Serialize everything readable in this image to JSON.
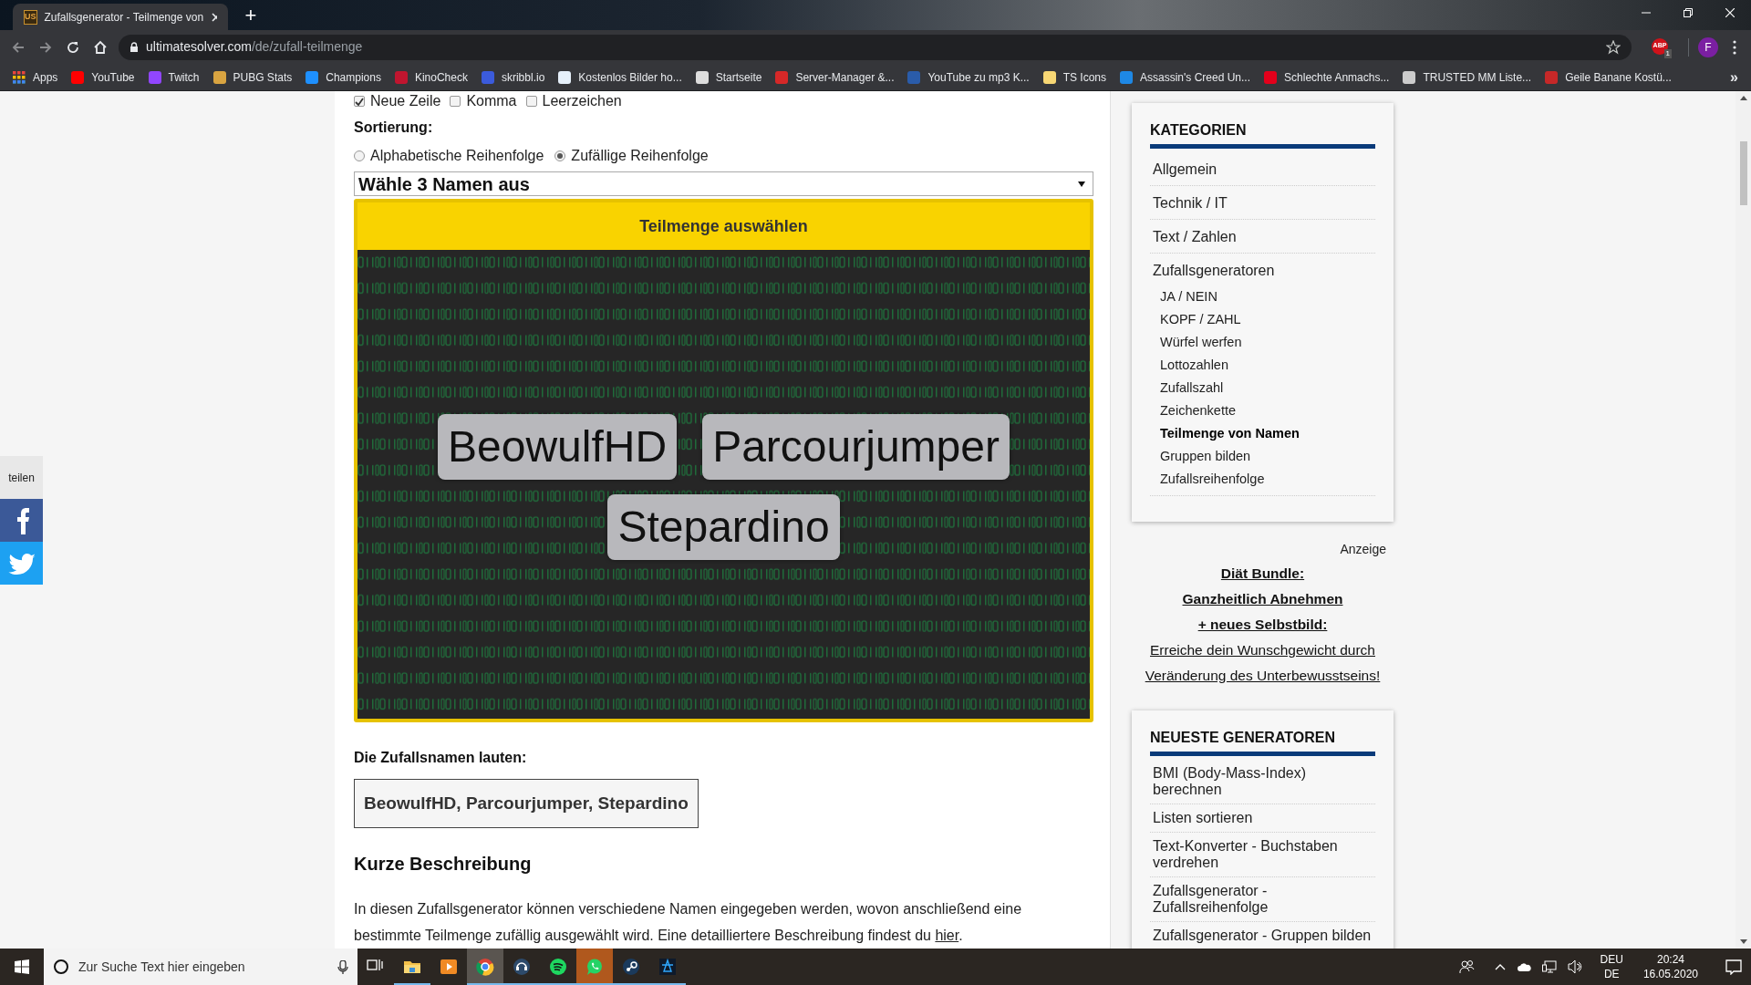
{
  "browser": {
    "tab_favicon": "US",
    "tab_title": "Zufallsgenerator - Teilmenge von",
    "new_tab": "+",
    "url_host": "ultimatesolver.com",
    "url_path": "/de/zufall-teilmenge",
    "extension_label": "ABP",
    "extension_badge": "1",
    "profile_initial": "F",
    "bookmarks_more": "»",
    "bookmarks": [
      {
        "label": "Apps"
      },
      {
        "label": "YouTube",
        "color": "#ff0000"
      },
      {
        "label": "Twitch",
        "color": "#9146ff"
      },
      {
        "label": "PUBG Stats",
        "color": "#d9a441"
      },
      {
        "label": "Champions",
        "color": "#1e90ff"
      },
      {
        "label": "KinoCheck",
        "color": "#c0152f"
      },
      {
        "label": "skribbl.io",
        "color": "#3b5bdb"
      },
      {
        "label": "Kostenlos Bilder ho...",
        "color": "#e6f0fa"
      },
      {
        "label": "Startseite",
        "color": "#dddddd"
      },
      {
        "label": "Server-Manager &...",
        "color": "#d62828"
      },
      {
        "label": "YouTube zu mp3 K...",
        "color": "#2a5caa"
      },
      {
        "label": "TS Icons",
        "color": "#f7d774"
      },
      {
        "label": "Assassin's Creed Un...",
        "color": "#1e88e5"
      },
      {
        "label": "Schlechte Anmachs...",
        "color": "#e3001b"
      },
      {
        "label": "TRUSTED MM Liste...",
        "color": "#cccccc"
      },
      {
        "label": "Geile Banane Kostü...",
        "color": "#c62828"
      }
    ]
  },
  "share": {
    "label": "teilen"
  },
  "form": {
    "output_options": [
      {
        "label": "Neue Zeile",
        "checked": true
      },
      {
        "label": "Komma",
        "checked": false
      },
      {
        "label": "Leerzeichen",
        "checked": false
      }
    ],
    "sort_label": "Sortierung:",
    "sort_options": [
      {
        "label": "Alphabetische Reihenfolge",
        "selected": false
      },
      {
        "label": "Zufällige Reihenfolge",
        "selected": true
      }
    ],
    "count_select": "Wähle 3 Namen aus",
    "submit": "Teilmenge auswählen",
    "picked_names": [
      "BeowulfHD",
      "Parcourjumper",
      "Stepardino"
    ]
  },
  "result": {
    "label": "Die Zufallsnamen lauten:",
    "value": "BeowulfHD, Parcourjumper, Stepardino"
  },
  "description": {
    "heading": "Kurze Beschreibung",
    "text": "In diesen Zufallsgenerator können verschiedene Namen eingegeben werden, wovon anschließend eine bestimmte Teilmenge zufällig ausgewählt wird. Eine detailliertere Beschreibung findest du ",
    "link": "hier",
    "end": "."
  },
  "sidebar": {
    "categories_title": "KATEGORIEN",
    "categories": [
      {
        "label": "Allgemein",
        "selected": false
      },
      {
        "label": "Technik / IT",
        "selected": false
      },
      {
        "label": "Text / Zahlen",
        "selected": false
      },
      {
        "label": "Zufallsgeneratoren",
        "selected": false,
        "children": [
          {
            "label": "JA / NEIN",
            "selected": false
          },
          {
            "label": "KOPF / ZAHL",
            "selected": false
          },
          {
            "label": "Würfel werfen",
            "selected": false
          },
          {
            "label": "Lottozahlen",
            "selected": false
          },
          {
            "label": "Zufallszahl",
            "selected": false
          },
          {
            "label": "Zeichenkette",
            "selected": false
          },
          {
            "label": "Teilmenge von Namen",
            "selected": true
          },
          {
            "label": "Gruppen bilden",
            "selected": false
          },
          {
            "label": "Zufallsreihenfolge",
            "selected": false
          }
        ]
      }
    ],
    "ad_label": "Anzeige",
    "ad_lines": [
      {
        "text": "Diät Bundle:",
        "bold": true
      },
      {
        "text": "Ganzheitlich Abnehmen",
        "bold": true
      },
      {
        "text": "+ neues Selbstbild:",
        "bold": true
      },
      {
        "text": "Erreiche dein Wunschgewicht durch",
        "bold": false
      },
      {
        "text": "Veränderung des Unterbewusstseins!",
        "bold": false
      }
    ],
    "newest_title": "NEUESTE GENERATOREN",
    "newest": [
      "BMI (Body-Mass-Index) berechnen",
      "Listen sortieren",
      "Text-Konverter - Buchstaben verdrehen",
      "Zufallsgenerator - Zufallsreihenfolge",
      "Zufallsgenerator - Gruppen bilden"
    ]
  },
  "taskbar": {
    "search_placeholder": "Zur Suche Text hier eingeben",
    "apps": [
      {
        "kind": "task-view",
        "running": false,
        "selected": false
      },
      {
        "kind": "folder",
        "running": true,
        "selected": false
      },
      {
        "kind": "media",
        "running": false,
        "selected": false
      },
      {
        "kind": "chrome",
        "running": true,
        "selected": true
      },
      {
        "kind": "headset",
        "running": true,
        "selected": false
      },
      {
        "kind": "spotify",
        "running": true,
        "selected": false
      },
      {
        "kind": "whatsapp",
        "running": true,
        "selected": false
      },
      {
        "kind": "steam",
        "running": true,
        "selected": false
      },
      {
        "kind": "battlenet",
        "running": true,
        "selected": false
      }
    ],
    "language": "DEU",
    "layout": "DE",
    "time": "20:24",
    "date": "16.05.2020"
  }
}
